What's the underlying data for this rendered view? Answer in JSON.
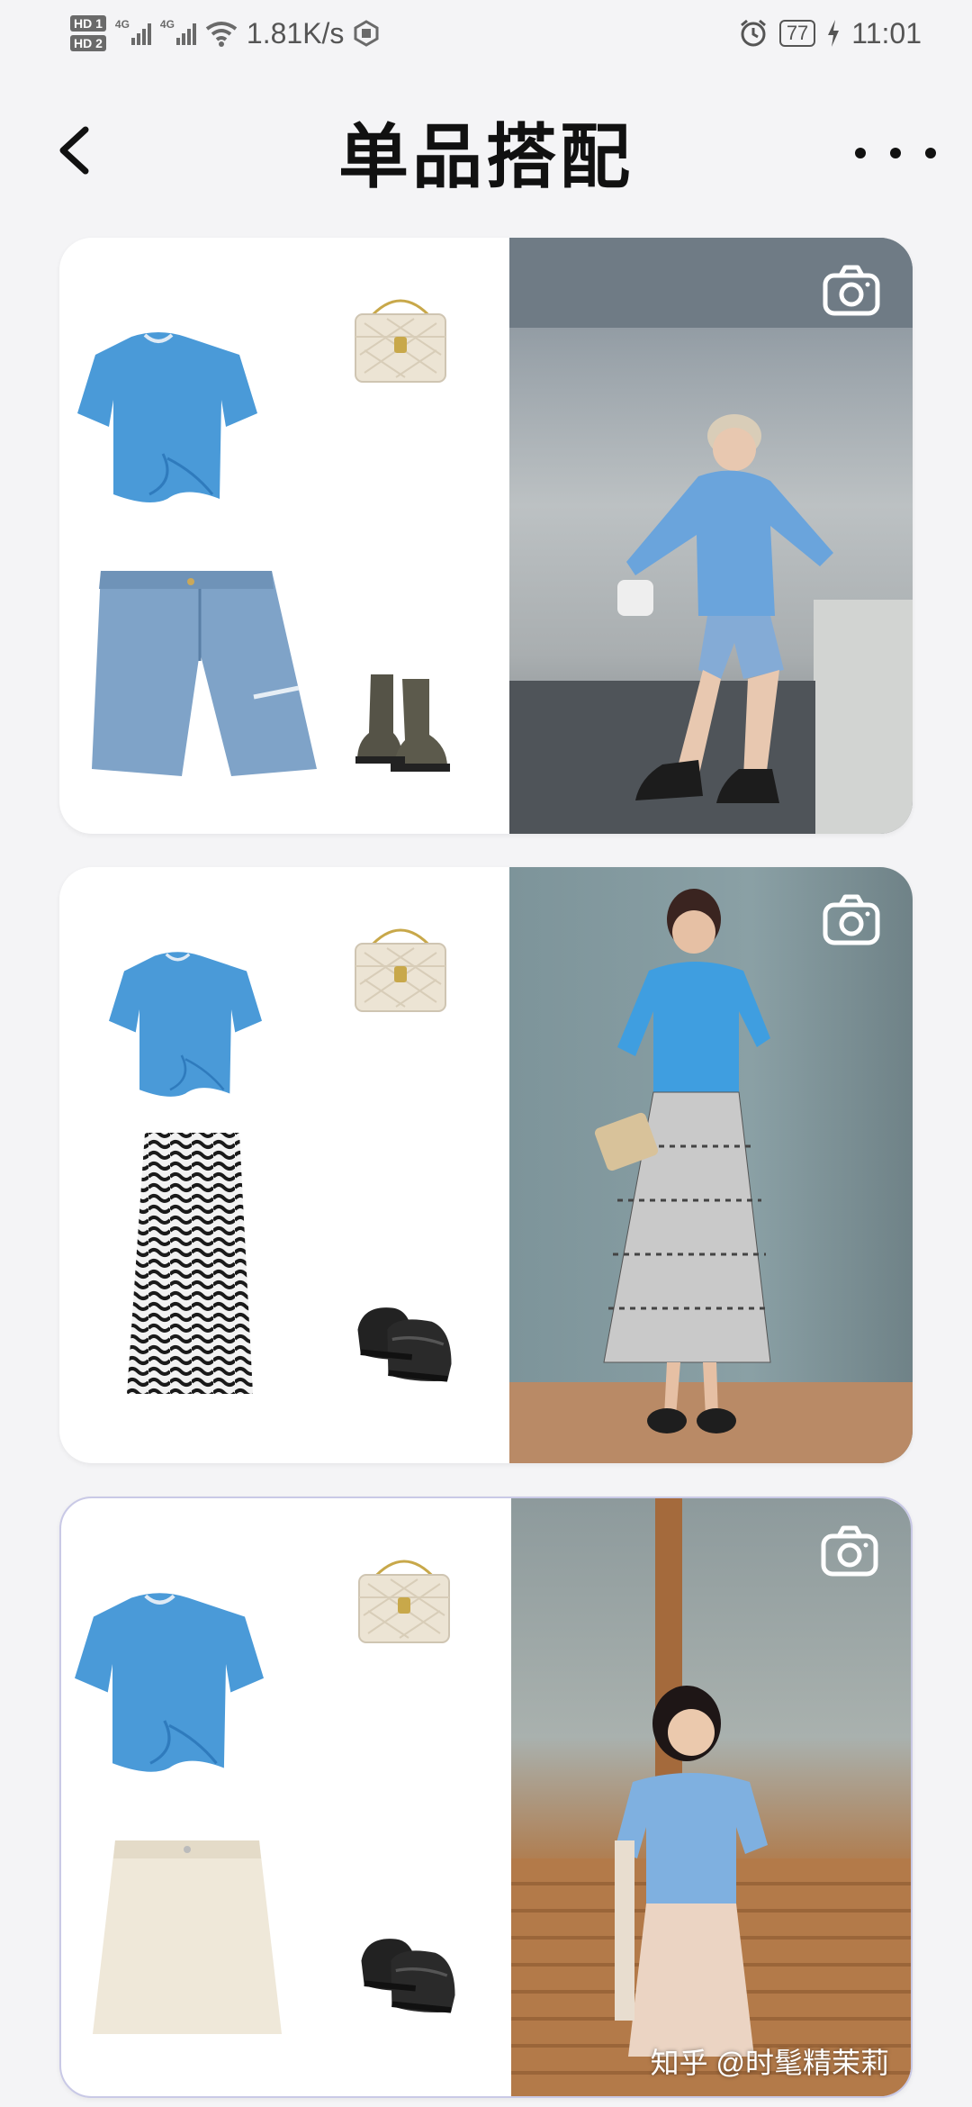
{
  "status_bar": {
    "hd1": "HD 1",
    "hd2": "HD 2",
    "net1": "4G",
    "net2": "4G",
    "speed": "1.81K/s",
    "battery": "77",
    "time": "11:01"
  },
  "header": {
    "title": "单品搭配"
  },
  "cards": [
    {
      "items": [
        "blue-twist-tee",
        "quilted-chain-bag",
        "denim-shorts",
        "olive-chelsea-boots"
      ]
    },
    {
      "items": [
        "blue-twist-tee",
        "quilted-chain-bag",
        "zebra-print-skirt",
        "black-loafers"
      ]
    },
    {
      "items": [
        "blue-twist-tee",
        "quilted-chain-bag",
        "cream-mini-skirt",
        "black-loafers"
      ]
    }
  ],
  "watermark": "知乎 @时髦精茉莉",
  "colors": {
    "tee_blue": "#4a9ad8",
    "denim": "#7fa3c8",
    "bag_cream": "#e9e1d2",
    "background": "#f4f4f6"
  }
}
